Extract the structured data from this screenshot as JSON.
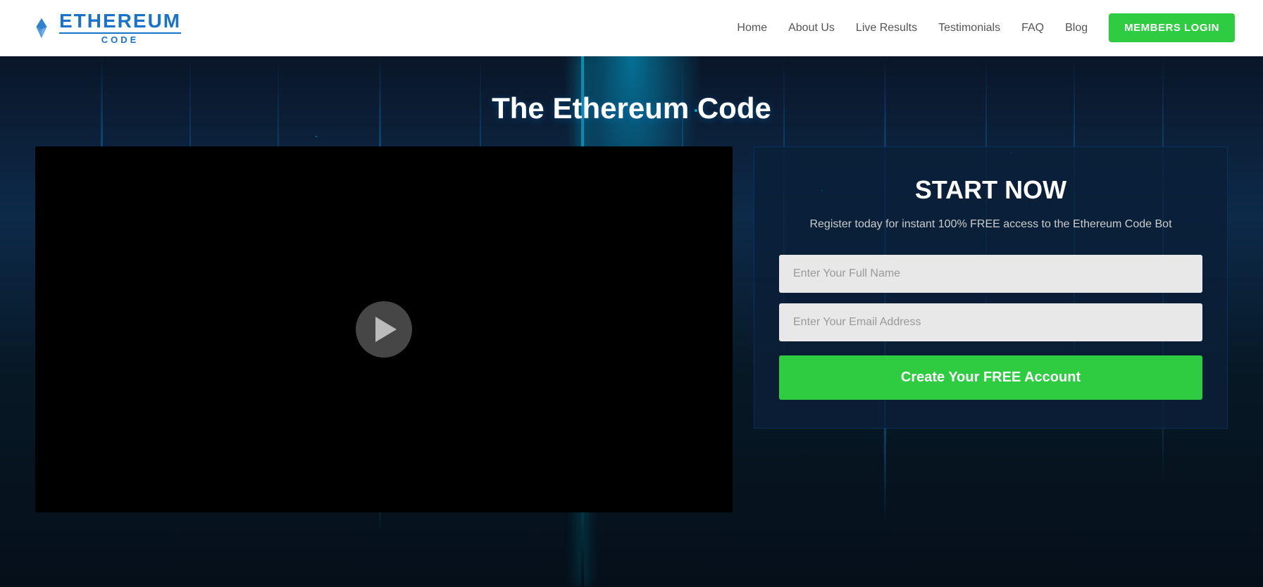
{
  "header": {
    "logo": {
      "ethereum_text": "ETHEREUM",
      "code_text": "CODE"
    },
    "nav": {
      "items": [
        {
          "label": "Home",
          "id": "home"
        },
        {
          "label": "About Us",
          "id": "about"
        },
        {
          "label": "Live Results",
          "id": "live-results"
        },
        {
          "label": "Testimonials",
          "id": "testimonials"
        },
        {
          "label": "FAQ",
          "id": "faq"
        },
        {
          "label": "Blog",
          "id": "blog"
        }
      ],
      "members_login_label": "MEMBERS LOGIN"
    }
  },
  "hero": {
    "title": "The Ethereum Code",
    "video": {
      "play_label": "Play"
    },
    "signup": {
      "title": "START NOW",
      "subtitle": "Register today for instant 100% FREE access to the Ethereum Code Bot",
      "full_name_placeholder": "Enter Your Full Name",
      "email_placeholder": "Enter Your Email Address",
      "submit_label": "Create Your FREE Account"
    }
  }
}
